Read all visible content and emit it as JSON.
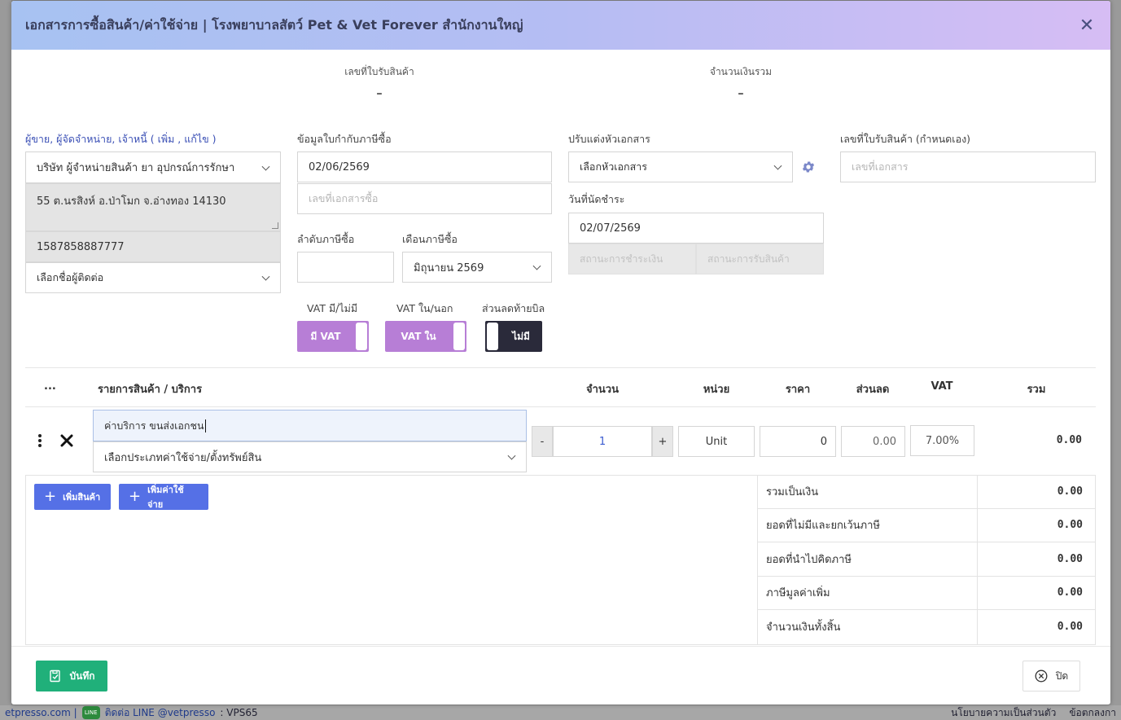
{
  "modal": {
    "title": "เอกสารการซื้อสินค้า/ค่าใช้จ่าย | โรงพยาบาลสัตว์ Pet & Vet Forever สำนักงานใหญ่",
    "close_icon": "close-icon"
  },
  "summary": {
    "receipt_no_label": "เลขที่ใบรับสินค้า",
    "receipt_no_value": "-",
    "total_label": "จำนวนเงินรวม",
    "total_value": "-"
  },
  "vendor": {
    "label": "ผู้ขาย, ผู้จัดจำหน่าย, เจ้าหนี้ ( เพิ่ม , แก้ไข )",
    "selected": "บริษัท ผู้จำหน่ายสินค้า ยา อุปกรณ์การรักษา",
    "address": "55 ต.นรสิงห์ อ.ป่าโมก จ.อ่างทอง 14130",
    "tax_id": "1587858887777",
    "contact_placeholder": "เลือกชื่อผู้ติดต่อ"
  },
  "tax_invoice": {
    "label": "ข้อมูลใบกำกับภาษีซื้อ",
    "date": "02/06/2569",
    "doc_no_placeholder": "เลขที่เอกสารซื้อ",
    "order_label": "ลำดับภาษีซื้อ",
    "order_value": "",
    "month_label": "เดือนภาษีซื้อ",
    "month_value": "มิถุนายน 2569"
  },
  "header_doc": {
    "label": "ปรับแต่งหัวเอกสาร",
    "select_value": "เลือกหัวเอกสาร",
    "due_label": "วันที่นัดชำระ",
    "due_date": "02/07/2569",
    "pay_status_placeholder": "สถานะการชำระเงิน",
    "receive_status_placeholder": "สถานะการรับสินค้า"
  },
  "custom_receipt": {
    "label": "เลขที่ใบรับสินค้า (กำหนดเอง)",
    "placeholder": "เลขที่เอกสาร"
  },
  "toggles": {
    "vat_label": "VAT มี/ไม่มี",
    "vat_value": "มี VAT",
    "vat_type_label": "VAT ใน/นอก",
    "vat_type_value": "VAT ใน",
    "discount_label": "ส่วนลดท้ายบิล",
    "discount_value": "ไม่มี"
  },
  "table": {
    "headers": {
      "menu": "...",
      "item": "รายการสินค้า / บริการ",
      "qty": "จำนวน",
      "unit": "หน่วย",
      "price": "ราคา",
      "discount": "ส่วนลด",
      "vat": "VAT",
      "total": "รวม"
    },
    "rows": [
      {
        "name": "ค่าบริการ ขนส่งเอกชน",
        "category_placeholder": "เลือกประเภทค่าใช้จ่าย/ตั้งทรัพย์สิน",
        "qty_minus": "-",
        "qty": "1",
        "qty_plus": "+",
        "unit": "Unit",
        "price": "0",
        "discount": "0.00",
        "vat": "7.00%",
        "total": "0.00"
      }
    ]
  },
  "buttons": {
    "add_product": "เพิ่มสินค้า",
    "add_expense": "เพิ่มค่าใช้จ่าย",
    "save": "บันทึก",
    "close": "ปิด"
  },
  "totals": [
    {
      "label": "รวมเป็นเงิน",
      "value": "0.00"
    },
    {
      "label": "ยอดที่ไม่มีและยกเว้นภาษี",
      "value": "0.00"
    },
    {
      "label": "ยอดที่นำไปคิดภาษี",
      "value": "0.00"
    },
    {
      "label": "ภาษีมูลค่าเพิ่ม",
      "value": "0.00"
    },
    {
      "label": "จำนวนเงินทั้งสิ้น",
      "value": "0.00"
    }
  ],
  "footer_bg": {
    "site": "etpresso.com |",
    "line_badge": "LINE",
    "line_text": "ติดต่อ LINE @vetpresso",
    "line_suffix": ": VPS65",
    "privacy": "นโยบายความเป็นส่วนตัว",
    "terms": "ข้อตกลงกา"
  },
  "colors": {
    "accent_blue": "#5570e6",
    "toggle_purple": "#b77ed6",
    "toggle_dark": "#2a2a3a",
    "save_green": "#20b07a"
  }
}
